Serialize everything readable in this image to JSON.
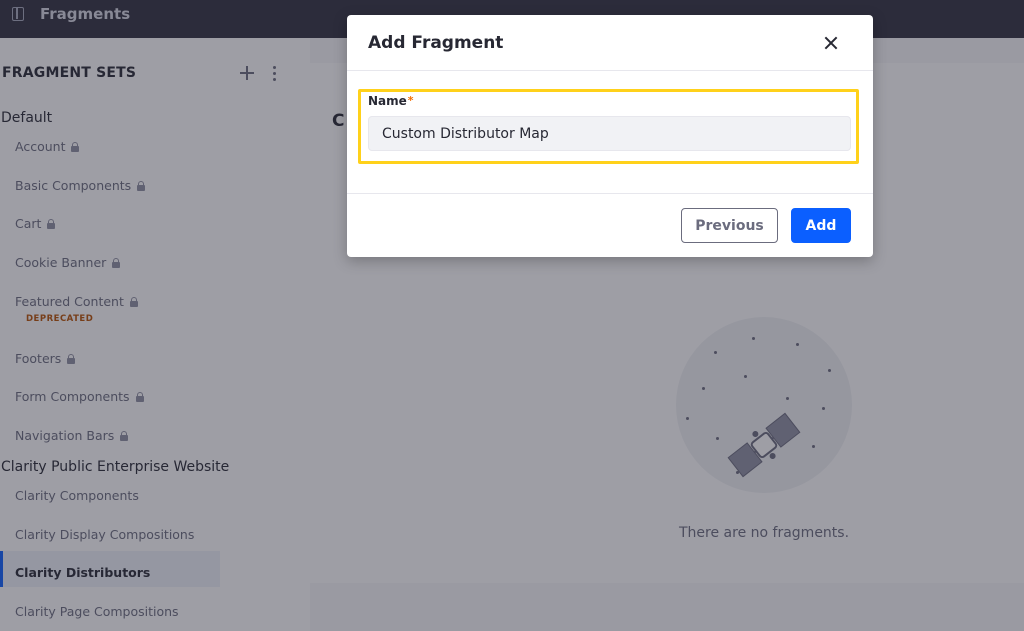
{
  "topbar": {
    "title": "Fragments",
    "icon": "side-panel-icon"
  },
  "sidebar": {
    "heading": "FRAGMENT SETS",
    "groups": [
      {
        "label": "Default",
        "items": [
          {
            "label": "Account",
            "locked": true
          },
          {
            "label": "Basic Components",
            "locked": true
          },
          {
            "label": "Cart",
            "locked": true
          },
          {
            "label": "Cookie Banner",
            "locked": true
          },
          {
            "label": "Featured Content",
            "locked": true,
            "badge": "DEPRECATED"
          },
          {
            "label": "Footers",
            "locked": true
          },
          {
            "label": "Form Components",
            "locked": true
          },
          {
            "label": "Navigation Bars",
            "locked": true
          }
        ]
      },
      {
        "label": "Clarity Public Enterprise Website",
        "items": [
          {
            "label": "Clarity Components"
          },
          {
            "label": "Clarity Display Compositions"
          },
          {
            "label": "Clarity Distributors",
            "active": true
          },
          {
            "label": "Clarity Page Compositions"
          }
        ]
      }
    ]
  },
  "main": {
    "heading_fragment": "C",
    "empty_message": "There are no fragments."
  },
  "modal": {
    "title": "Add Fragment",
    "field_label": "Name",
    "required_mark": "*",
    "name_value": "Custom Distributor Map",
    "previous_label": "Previous",
    "add_label": "Add"
  },
  "colors": {
    "primary": "#0b5fff",
    "highlight": "#ffd11a",
    "required": "#f26d00",
    "deprecated": "#b95000",
    "topbar": "#30313f"
  }
}
